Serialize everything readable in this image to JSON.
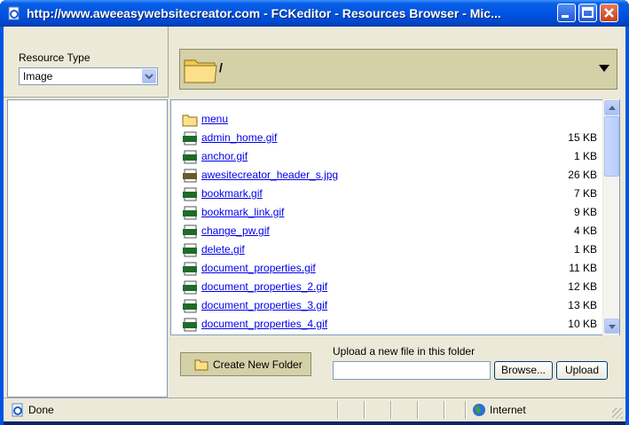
{
  "window": {
    "title": "http://www.aweeasywebsitecreator.com - FCKeditor - Resources Browser - Mic..."
  },
  "resource_type": {
    "label": "Resource Type",
    "selected": "Image"
  },
  "path_bar": {
    "current_path": "/"
  },
  "files": [
    {
      "name": "menu",
      "size": "",
      "icon": "folder-icon"
    },
    {
      "name": "admin_home.gif",
      "size": "15 KB",
      "icon": "gif-file-icon"
    },
    {
      "name": "anchor.gif",
      "size": "1 KB",
      "icon": "gif-file-icon"
    },
    {
      "name": "awesitecreator_header_s.jpg",
      "size": "26 KB",
      "icon": "jpg-file-icon"
    },
    {
      "name": "bookmark.gif",
      "size": "7 KB",
      "icon": "gif-file-icon"
    },
    {
      "name": "bookmark_link.gif",
      "size": "9 KB",
      "icon": "gif-file-icon"
    },
    {
      "name": "change_pw.gif",
      "size": "4 KB",
      "icon": "gif-file-icon"
    },
    {
      "name": "delete.gif",
      "size": "1 KB",
      "icon": "gif-file-icon"
    },
    {
      "name": "document_properties.gif",
      "size": "11 KB",
      "icon": "gif-file-icon"
    },
    {
      "name": "document_properties_2.gif",
      "size": "12 KB",
      "icon": "gif-file-icon"
    },
    {
      "name": "document_properties_3.gif",
      "size": "13 KB",
      "icon": "gif-file-icon"
    },
    {
      "name": "document_properties_4.gif",
      "size": "10 KB",
      "icon": "gif-file-icon"
    }
  ],
  "bottom": {
    "create_folder_label": "Create New Folder",
    "upload_label": "Upload a new file in this folder",
    "browse_label": "Browse...",
    "upload_button_label": "Upload"
  },
  "status": {
    "text": "Done",
    "zone": "Internet"
  },
  "colors": {
    "titlebar": "#0054e3",
    "link": "#0000ee",
    "path_bar_bg": "#d4d0a7"
  }
}
